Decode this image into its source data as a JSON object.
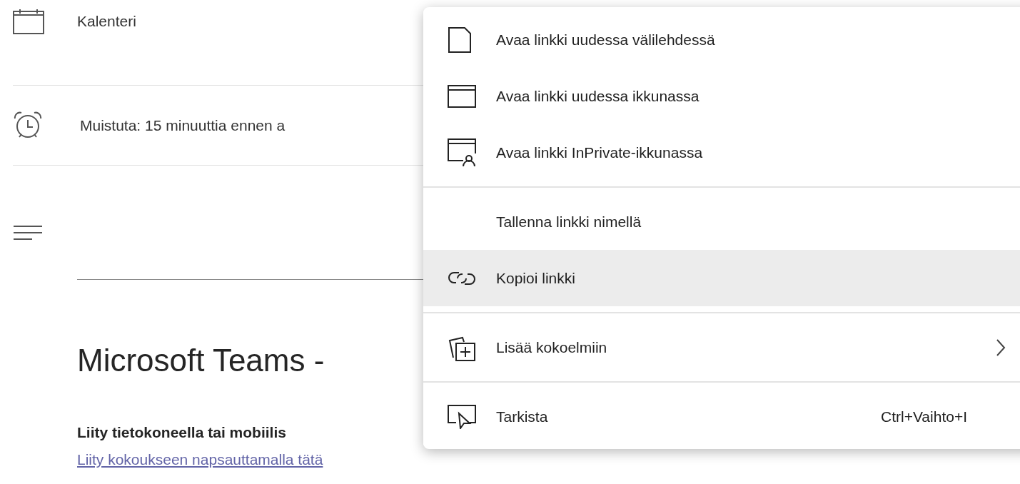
{
  "calendar": {
    "label": "Kalenteri"
  },
  "reminder": {
    "label": "Muistuta: 15 minuuttia ennen a"
  },
  "body": {
    "title": "Microsoft Teams -",
    "join_heading": "Liity tietokoneella tai mobiilis",
    "join_link": "Liity kokoukseen napsauttamalla tätä"
  },
  "context_menu": {
    "groups": [
      [
        {
          "label": "Avaa linkki uudessa välilehdessä",
          "selected": false,
          "submenu": false
        },
        {
          "label": "Avaa linkki uudessa ikkunassa",
          "selected": false,
          "submenu": false
        },
        {
          "label": "Avaa linkki InPrivate-ikkunassa",
          "selected": false,
          "submenu": false
        }
      ],
      [
        {
          "label": "Tallenna linkki nimellä",
          "selected": false,
          "submenu": false
        },
        {
          "label": "Kopioi linkki",
          "selected": true,
          "submenu": false
        }
      ],
      [
        {
          "label": "Lisää kokoelmiin",
          "selected": false,
          "submenu": true
        }
      ],
      [
        {
          "label": "Tarkista",
          "selected": false,
          "submenu": false,
          "shortcut": "Ctrl+Vaihto+I"
        }
      ]
    ]
  }
}
